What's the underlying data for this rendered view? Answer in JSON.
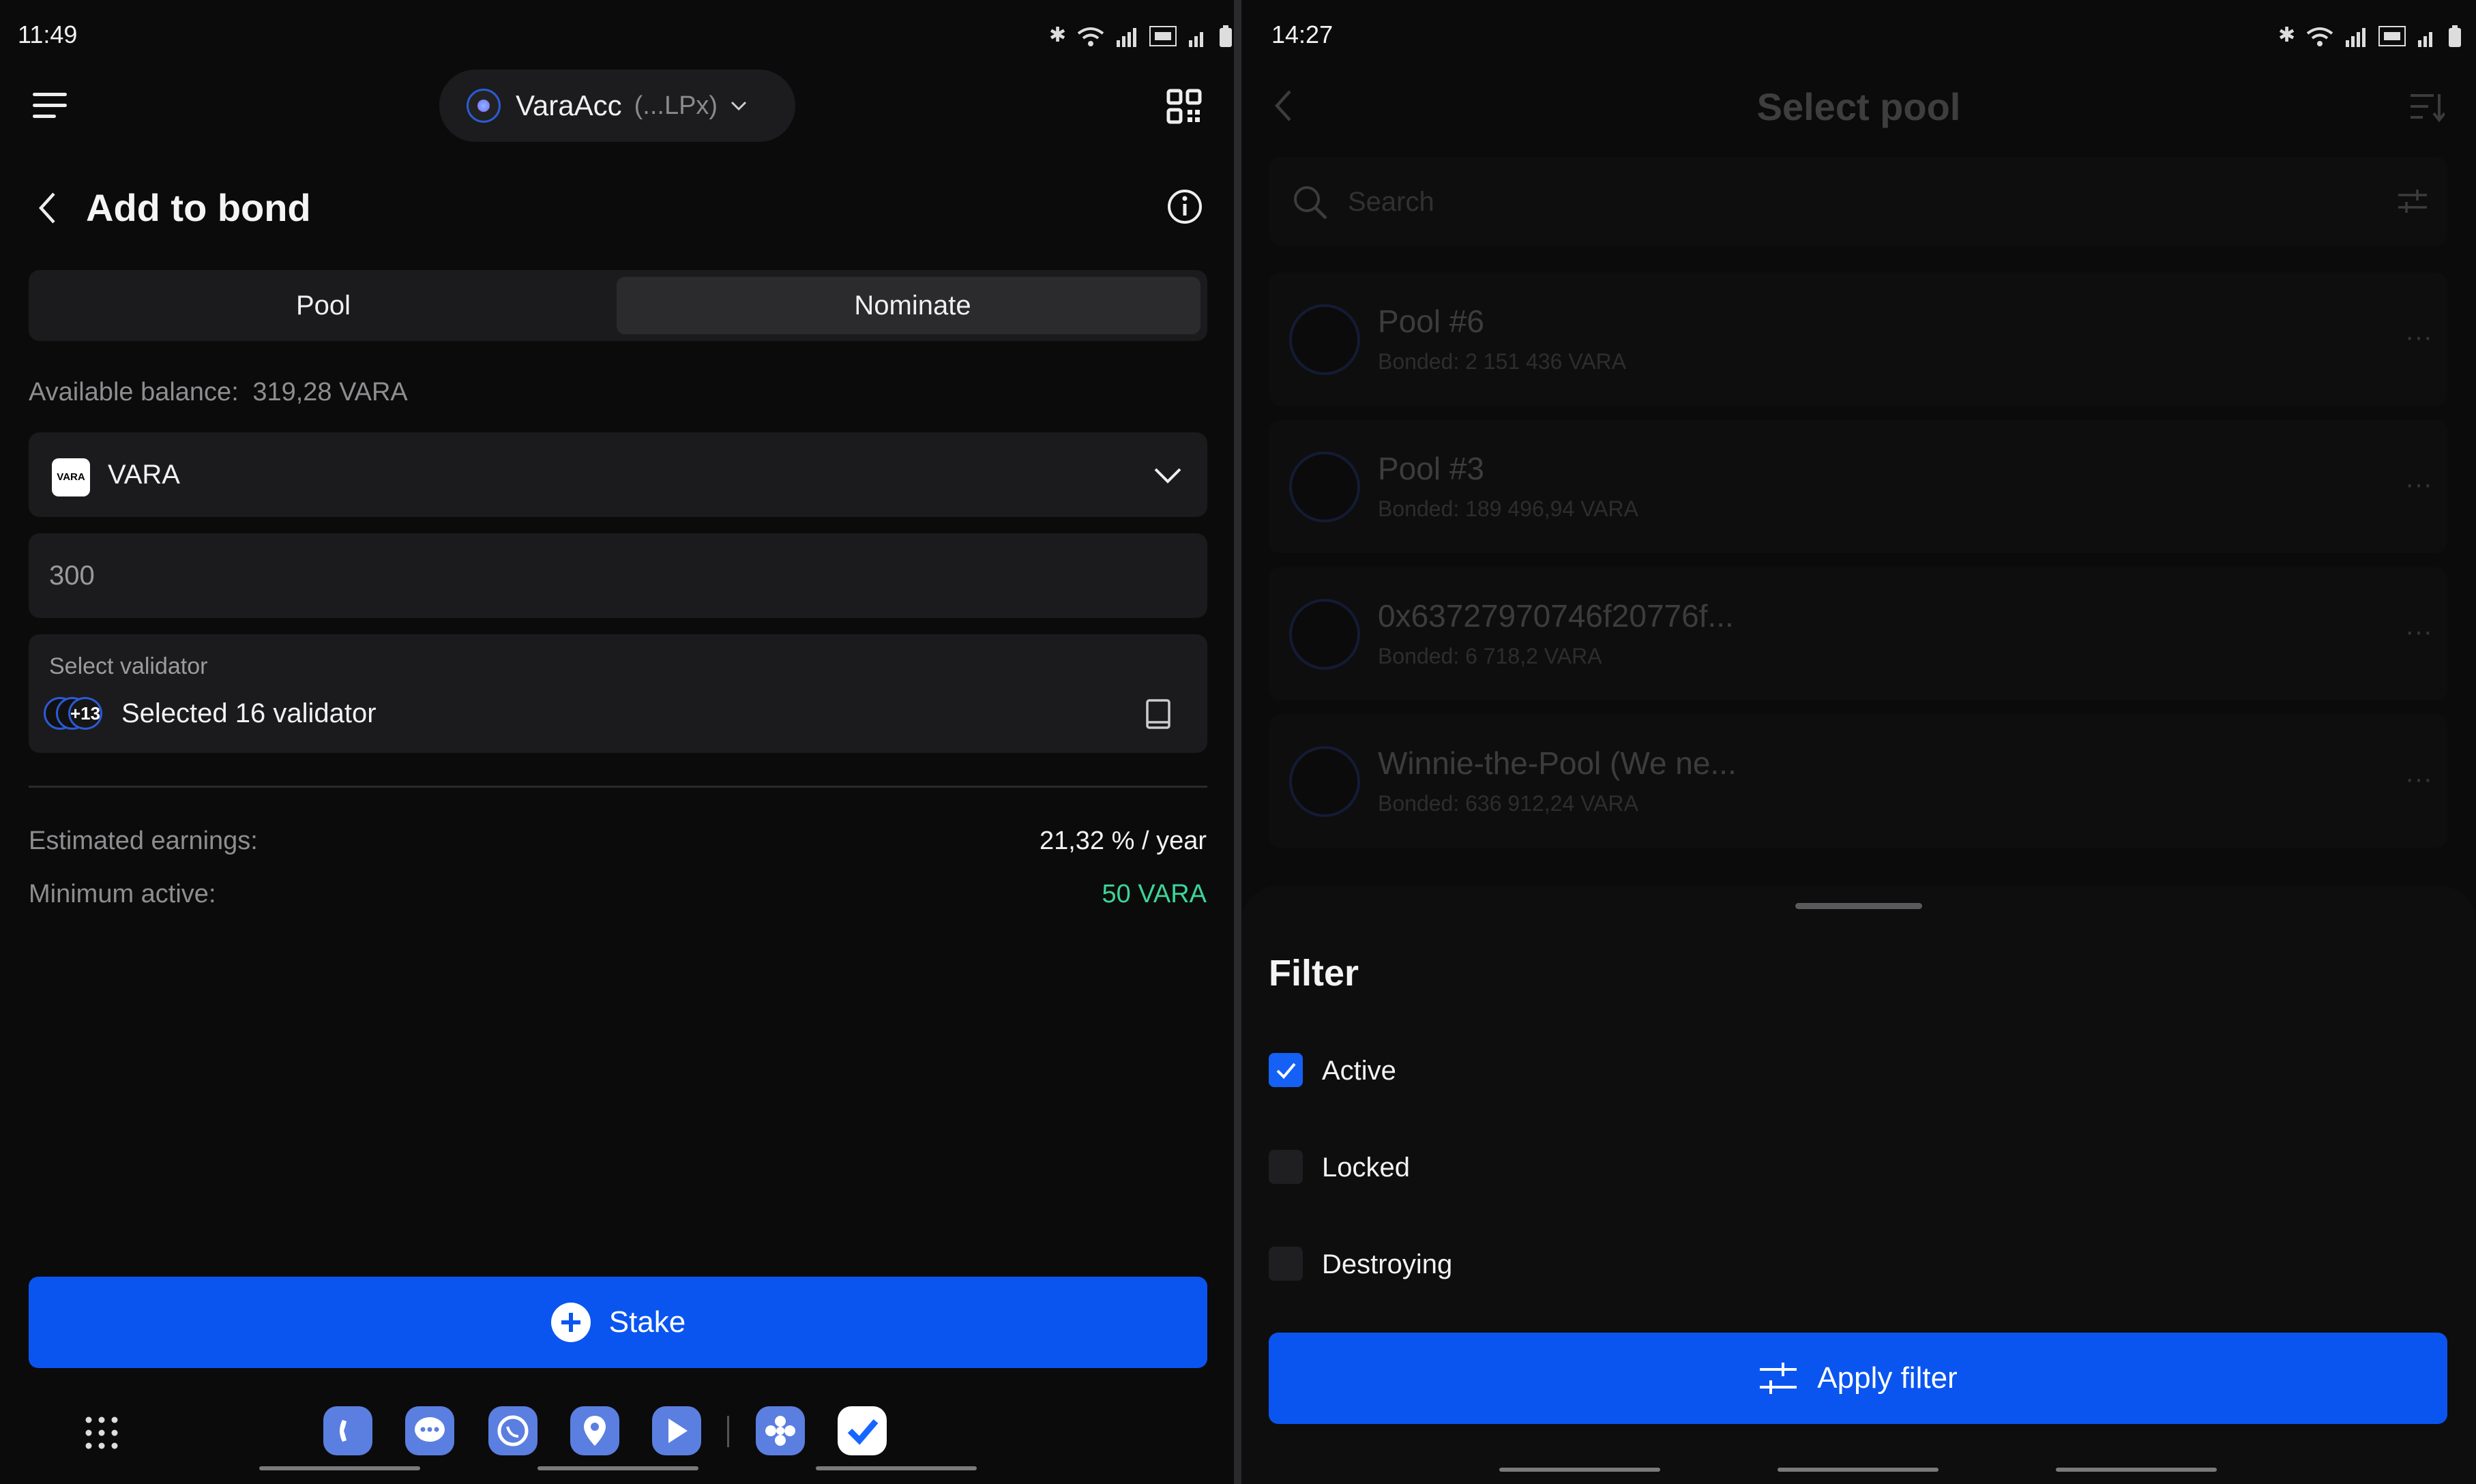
{
  "left": {
    "status": {
      "time": "11:49"
    },
    "account": {
      "name": "VaraAcc",
      "short": "(...LPx)"
    },
    "header": {
      "title": "Add to bond"
    },
    "tabs": [
      {
        "label": "Pool"
      },
      {
        "label": "Nominate"
      }
    ],
    "balance": {
      "label": "Available balance:",
      "value": "319,28 VARA"
    },
    "token": {
      "name": "VARA",
      "logo_text": "VARA"
    },
    "amount": {
      "value": "300"
    },
    "validator": {
      "label": "Select validator",
      "badge": "+13",
      "selected": "Selected 16 validator"
    },
    "stats": {
      "earnings_label": "Estimated earnings:",
      "earnings_value": "21,32 % / year",
      "min_label": "Minimum active:",
      "min_value": "50 VARA"
    },
    "stake_button": "Stake"
  },
  "right": {
    "status": {
      "time": "14:27"
    },
    "header": {
      "title": "Select pool"
    },
    "search": {
      "placeholder": "Search"
    },
    "pools": [
      {
        "name": "Pool #6",
        "bonded": "Bonded: 2 151 436 VARA"
      },
      {
        "name": "Pool #3",
        "bonded": "Bonded: 189 496,94 VARA"
      },
      {
        "name": "0x63727970746f20776f...",
        "bonded": "Bonded: 6 718,2 VARA"
      },
      {
        "name": "Winnie-the-Pool (We ne...",
        "bonded": "Bonded: 636 912,24 VARA"
      }
    ],
    "filter": {
      "title": "Filter",
      "options": [
        {
          "label": "Active",
          "checked": true
        },
        {
          "label": "Locked",
          "checked": false
        },
        {
          "label": "Destroying",
          "checked": false
        }
      ],
      "apply_button": "Apply filter"
    }
  },
  "colors": {
    "accent": "#0a55f0",
    "green": "#3dd598",
    "card": "#1b1b1d",
    "background": "#0b0b0c"
  }
}
